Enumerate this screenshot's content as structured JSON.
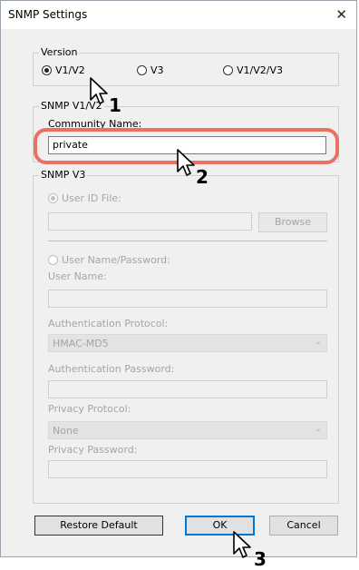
{
  "window": {
    "title": "SNMP Settings",
    "close_glyph": "✕"
  },
  "version": {
    "legend": "Version",
    "options": [
      "V1/V2",
      "V3",
      "V1/V2/V3"
    ],
    "selected": "V1/V2"
  },
  "snmp_v1v2": {
    "legend": "SNMP V1/V2",
    "community_label": "Community Name:",
    "community_value": "private"
  },
  "snmp_v3": {
    "legend": "SNMP V3",
    "user_id_file_label": "User ID File:",
    "browse_label": "Browse",
    "user_name_password_label": "User Name/Password:",
    "user_name_label": "User Name:",
    "auth_protocol_label": "Authentication Protocol:",
    "auth_protocol_value": "HMAC-MD5",
    "auth_password_label": "Authentication Password:",
    "privacy_protocol_label": "Privacy Protocol:",
    "privacy_protocol_value": "None",
    "privacy_password_label": "Privacy Password:"
  },
  "buttons": {
    "restore_default": "Restore Default",
    "ok": "OK",
    "cancel": "Cancel"
  },
  "callouts": [
    "1",
    "2",
    "3"
  ],
  "colors": {
    "highlight": "#e8725f",
    "accent": "#0078d7"
  }
}
